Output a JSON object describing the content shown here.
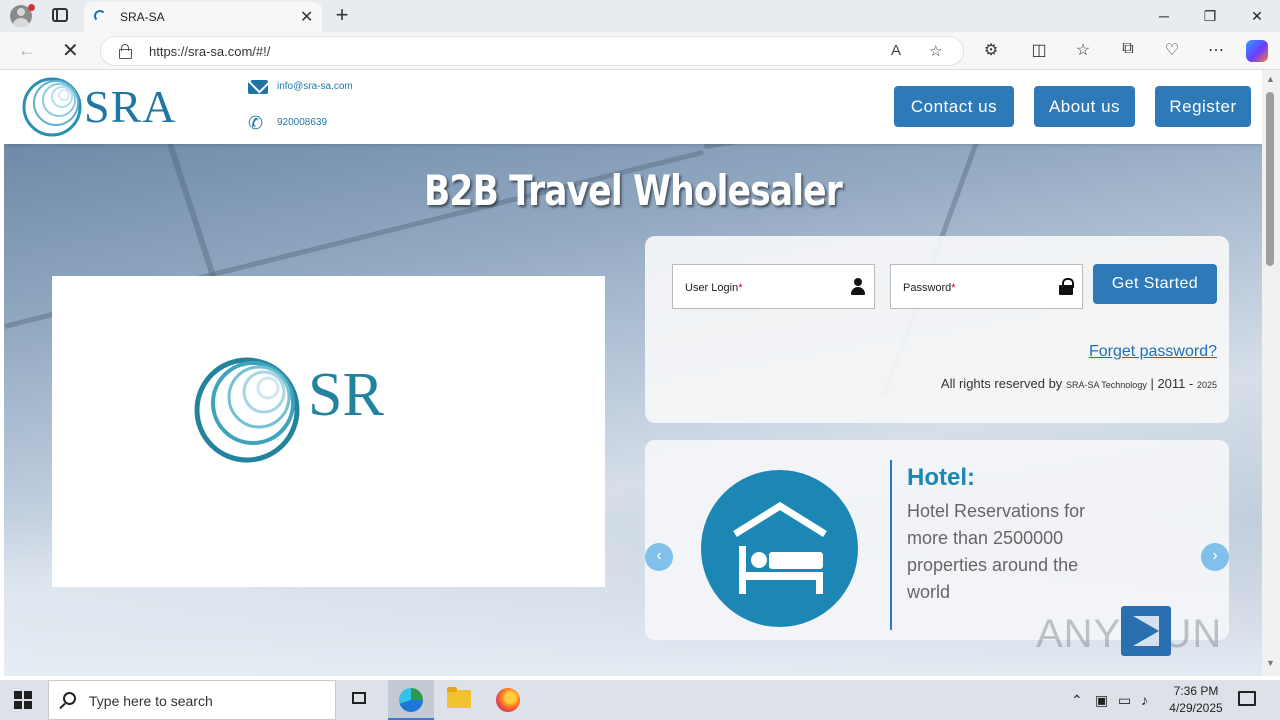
{
  "browser": {
    "tab_title": "SRA-SA",
    "url": "https://sra-sa.com/#!/",
    "win_min": "─",
    "win_restore": "❐",
    "win_close": "✕",
    "new_tab": "+",
    "tab_close": "✕"
  },
  "site": {
    "logo_text": "SRA",
    "email": "info@sra-sa.com",
    "phone": "920008639",
    "nav": {
      "contact": "Contact us",
      "about": "About us",
      "register": "Register"
    },
    "hero_title": "B2B Travel Wholesaler",
    "video_logo_text": "SR"
  },
  "login": {
    "user_label": "User Login",
    "password_label": "Password",
    "required_mark": "*",
    "submit": "Get Started",
    "forget": "Forget password?",
    "rights_prefix": "All rights reserved by",
    "rights_company": "SRA-SA Technology",
    "rights_years": "| 2011 -",
    "rights_year_end": "2025"
  },
  "hotel_slide": {
    "title": "Hotel:",
    "description": "Hotel Reservations for more than 2500000 properties around the world",
    "prev": "‹",
    "next": "›"
  },
  "watermark": "ANY RUN",
  "taskbar": {
    "search_placeholder": "Type here to search",
    "time": "7:36 PM",
    "date": "4/29/2025"
  },
  "colors": {
    "brand_blue": "#2e7ab8",
    "teal": "#1c86b4",
    "required_red": "#d0021b"
  }
}
